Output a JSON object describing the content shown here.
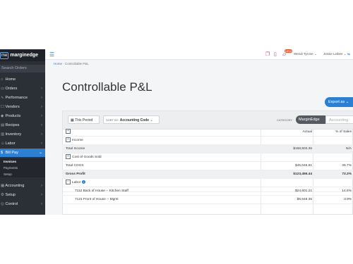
{
  "sidebar": {
    "logo_mark": "me",
    "logo_name": "marginedge",
    "search_placeholder": "Search Orders",
    "items": [
      {
        "icon": "⌂",
        "label": "Home"
      },
      {
        "icon": "▭",
        "label": "Orders"
      },
      {
        "icon": "∿",
        "label": "Performance"
      },
      {
        "icon": "☐",
        "label": "Vendors"
      },
      {
        "icon": "◆",
        "label": "Products"
      },
      {
        "icon": "▤",
        "label": "Recipes"
      },
      {
        "icon": "▥",
        "label": "Inventory"
      },
      {
        "icon": "☺",
        "label": "Labor"
      },
      {
        "icon": "$",
        "label": "Bill Pay"
      },
      {
        "icon": "▦",
        "label": "Accounting"
      },
      {
        "icon": "⚙",
        "label": "Setup"
      },
      {
        "icon": "◎",
        "label": "Control"
      }
    ],
    "subitems": [
      "Invoices",
      "Payments",
      "Setup"
    ]
  },
  "topbar": {
    "badge": "NEW",
    "user": "Wendi Tyrone",
    "location": "Jessie Leibee"
  },
  "breadcrumb": {
    "home": "Home",
    "current": "Controllable P&L"
  },
  "page_title": "Controllable P&L",
  "export_label": "Export as",
  "toolbar": {
    "period_label": "This Period",
    "sort_prefix": "SORT BY:",
    "sort_value": "Accounting Code",
    "category_label": "CATEGORY",
    "category_on": "MarginEdge",
    "category_off": "Accounting"
  },
  "table": {
    "headers": {
      "actual": "Actual",
      "pct": "% of Sales"
    },
    "rows": [
      {
        "label": "Income",
        "actual": "",
        "pct": ""
      },
      {
        "label": "Total Income",
        "actual": "$168,503.35",
        "pct": "N/A"
      },
      {
        "label": "Cost of Goods Sold",
        "actual": "",
        "pct": ""
      },
      {
        "label": "Total COGS",
        "actual": "$45,046.91",
        "pct": "26.7%"
      },
      {
        "label": "Gross Profit",
        "actual": "$123,456.44",
        "pct": "73.3%"
      },
      {
        "label": "Labor",
        "actual": "",
        "pct": ""
      },
      {
        "label": "7112 Back of House -- Kitchen Staff",
        "actual": "$24,601.21",
        "pct": "14.6%"
      },
      {
        "label": "7121 Front of House -- Mgmt",
        "actual": "$6,648.35",
        "pct": "3.9%"
      }
    ]
  },
  "colors": {
    "accent": "#2d7fd2",
    "sidebar": "#2b2f36",
    "active_nav": "#2d7fd2"
  }
}
